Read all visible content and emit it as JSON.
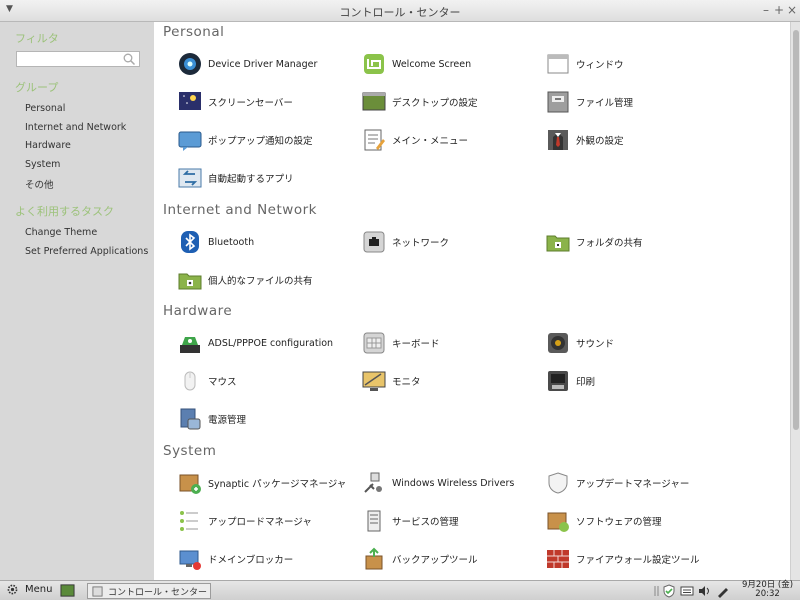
{
  "window": {
    "title": "コントロール・センター",
    "min": "–",
    "max": "+",
    "close": "×"
  },
  "sidebar": {
    "filter_heading": "フィルタ",
    "filter_value": "",
    "groups_heading": "グループ",
    "groups": [
      "Personal",
      "Internet and Network",
      "Hardware",
      "System",
      "その他"
    ],
    "tasks_heading": "よく利用するタスク",
    "tasks": [
      "Change Theme",
      "Set Preferred Applications"
    ]
  },
  "sections": [
    {
      "title": "Personal",
      "items": [
        {
          "label": "Device Driver Manager",
          "icon": "device-driver-icon"
        },
        {
          "label": "Welcome Screen",
          "icon": "mint-logo-icon"
        },
        {
          "label": "ウィンドウ",
          "icon": "window-icon"
        },
        {
          "label": "スクリーンセーバー",
          "icon": "screensaver-icon"
        },
        {
          "label": "デスクトップの設定",
          "icon": "desktop-icon"
        },
        {
          "label": "ファイル管理",
          "icon": "file-manager-icon"
        },
        {
          "label": "ポップアップ通知の設定",
          "icon": "notification-icon"
        },
        {
          "label": "メイン・メニュー",
          "icon": "main-menu-icon"
        },
        {
          "label": "外観の設定",
          "icon": "appearance-icon"
        },
        {
          "label": "自動起動するアプリ",
          "icon": "startup-apps-icon"
        }
      ]
    },
    {
      "title": "Internet and Network",
      "items": [
        {
          "label": "Bluetooth",
          "icon": "bluetooth-icon"
        },
        {
          "label": "ネットワーク",
          "icon": "network-icon"
        },
        {
          "label": "フォルダの共有",
          "icon": "folder-share-icon"
        },
        {
          "label": "個人的なファイルの共有",
          "icon": "personal-file-share-icon"
        }
      ]
    },
    {
      "title": "Hardware",
      "items": [
        {
          "label": "ADSL/PPPOE configuration",
          "icon": "adsl-icon"
        },
        {
          "label": "キーボード",
          "icon": "keyboard-icon"
        },
        {
          "label": "サウンド",
          "icon": "sound-icon"
        },
        {
          "label": "マウス",
          "icon": "mouse-icon"
        },
        {
          "label": "モニタ",
          "icon": "monitor-icon"
        },
        {
          "label": "印刷",
          "icon": "printer-icon"
        },
        {
          "label": "電源管理",
          "icon": "power-management-icon"
        }
      ]
    },
    {
      "title": "System",
      "items": [
        {
          "label": "Synaptic パッケージマネージャ",
          "icon": "synaptic-icon"
        },
        {
          "label": "Windows Wireless Drivers",
          "icon": "wireless-drivers-icon"
        },
        {
          "label": "アップデートマネージャー",
          "icon": "update-manager-icon"
        },
        {
          "label": "アップロードマネージャ",
          "icon": "upload-manager-icon"
        },
        {
          "label": "サービスの管理",
          "icon": "services-icon"
        },
        {
          "label": "ソフトウェアの管理",
          "icon": "software-manager-icon"
        },
        {
          "label": "ドメインブロッカー",
          "icon": "domain-blocker-icon"
        },
        {
          "label": "バックアップツール",
          "icon": "backup-icon"
        },
        {
          "label": "ファイアウォール設定ツール",
          "icon": "firewall-icon"
        }
      ]
    }
  ],
  "taskbar": {
    "menu_label": "Menu",
    "task_label": "コントロール・センター",
    "clock_date": "9月20日 (金)",
    "clock_time": "20:32"
  },
  "colors": {
    "accent_green": "#9cc27a",
    "group_title": "#666666"
  }
}
